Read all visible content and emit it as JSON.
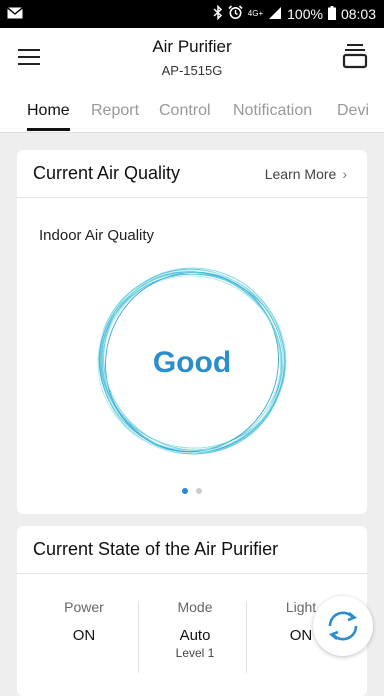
{
  "status_bar": {
    "left_icon": "mail-icon",
    "icons": [
      "bluetooth-icon",
      "alarm-icon",
      "network-4g-icon",
      "signal-icon"
    ],
    "network_label": "4G+",
    "battery_percent": "100%",
    "time": "08:03"
  },
  "header": {
    "title": "Air Purifier",
    "subtitle": "AP-1515G",
    "menu_icon": "hamburger-menu-icon",
    "right_icon": "device-stack-icon"
  },
  "tabs": [
    {
      "label": "Home",
      "active": true
    },
    {
      "label": "Report",
      "active": false
    },
    {
      "label": "Control",
      "active": false
    },
    {
      "label": "Notification",
      "active": false
    },
    {
      "label": "Devi",
      "active": false
    }
  ],
  "air_quality_card": {
    "title": "Current Air Quality",
    "learn_more": "Learn More",
    "indoor_label": "Indoor Air Quality",
    "status": "Good",
    "pager": {
      "count": 2,
      "active_index": 0
    }
  },
  "state_card": {
    "title": "Current State of the Air Purifier",
    "items": [
      {
        "label": "Power",
        "value": "ON",
        "sub": ""
      },
      {
        "label": "Mode",
        "value": "Auto",
        "sub": "Level 1"
      },
      {
        "label": "Light",
        "value": "ON",
        "sub": ""
      }
    ]
  },
  "refresh_button": {
    "icon": "refresh-icon"
  },
  "colors": {
    "accent": "#2a8dcc",
    "ring_light": "#8fe0e6",
    "ring_dark": "#3aa8d8",
    "background": "#eeeeee"
  }
}
